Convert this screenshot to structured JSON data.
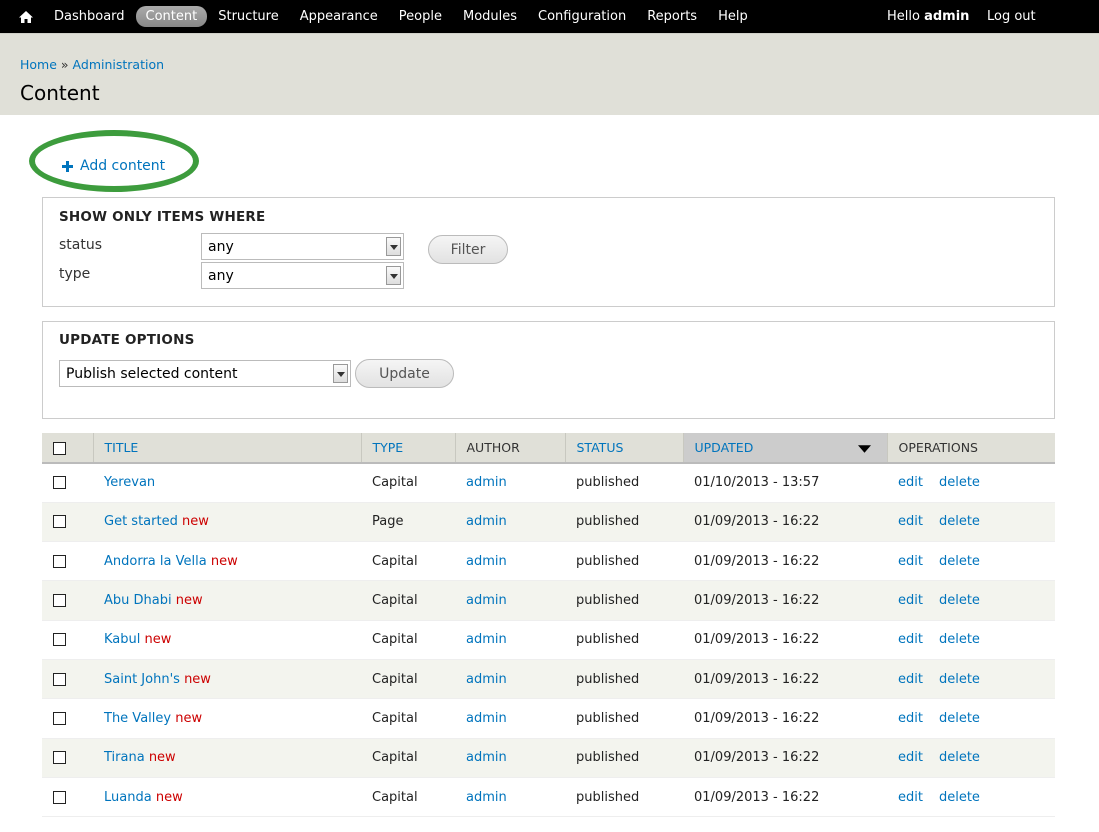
{
  "toolbar": {
    "menu": [
      {
        "label": "Dashboard",
        "active": false
      },
      {
        "label": "Content",
        "active": true
      },
      {
        "label": "Structure",
        "active": false
      },
      {
        "label": "Appearance",
        "active": false
      },
      {
        "label": "People",
        "active": false
      },
      {
        "label": "Modules",
        "active": false
      },
      {
        "label": "Configuration",
        "active": false
      },
      {
        "label": "Reports",
        "active": false
      },
      {
        "label": "Help",
        "active": false
      }
    ],
    "hello": "Hello",
    "username": "admin",
    "logout": "Log out"
  },
  "breadcrumb": {
    "home": "Home",
    "separator": "»",
    "admin": "Administration"
  },
  "page_title": "Content",
  "add_content": "Add content",
  "filter": {
    "legend": "SHOW ONLY ITEMS WHERE",
    "status_label": "status",
    "status_value": "any",
    "type_label": "type",
    "type_value": "any",
    "button": "Filter"
  },
  "update": {
    "legend": "UPDATE OPTIONS",
    "action_value": "Publish selected content",
    "button": "Update"
  },
  "table": {
    "headers": {
      "title": "TITLE",
      "type": "TYPE",
      "author": "AUTHOR",
      "status": "STATUS",
      "updated": "UPDATED",
      "operations": "OPERATIONS"
    },
    "edit": "edit",
    "delete": "delete",
    "rows": [
      {
        "title": "Yerevan",
        "marker": "",
        "type": "Capital",
        "author": "admin",
        "status": "published",
        "updated": "01/10/2013 - 13:57"
      },
      {
        "title": "Get started",
        "marker": "new",
        "type": "Page",
        "author": "admin",
        "status": "published",
        "updated": "01/09/2013 - 16:22"
      },
      {
        "title": "Andorra la Vella",
        "marker": "new",
        "type": "Capital",
        "author": "admin",
        "status": "published",
        "updated": "01/09/2013 - 16:22"
      },
      {
        "title": "Abu Dhabi",
        "marker": "new",
        "type": "Capital",
        "author": "admin",
        "status": "published",
        "updated": "01/09/2013 - 16:22"
      },
      {
        "title": "Kabul",
        "marker": "new",
        "type": "Capital",
        "author": "admin",
        "status": "published",
        "updated": "01/09/2013 - 16:22"
      },
      {
        "title": "Saint John's",
        "marker": "new",
        "type": "Capital",
        "author": "admin",
        "status": "published",
        "updated": "01/09/2013 - 16:22"
      },
      {
        "title": "The Valley",
        "marker": "new",
        "type": "Capital",
        "author": "admin",
        "status": "published",
        "updated": "01/09/2013 - 16:22"
      },
      {
        "title": "Tirana",
        "marker": "new",
        "type": "Capital",
        "author": "admin",
        "status": "published",
        "updated": "01/09/2013 - 16:22"
      },
      {
        "title": "Luanda",
        "marker": "new",
        "type": "Capital",
        "author": "admin",
        "status": "published",
        "updated": "01/09/2013 - 16:22"
      }
    ]
  },
  "colors": {
    "link": "#0074bd",
    "new_marker": "#cc0000",
    "highlight_oval": "#3d9c3d"
  }
}
